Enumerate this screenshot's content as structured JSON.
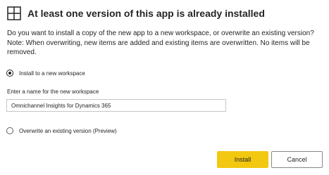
{
  "dialog": {
    "title": "At least one version of this app is already installed",
    "icon": "app-grid-icon",
    "description_line1": "Do you want to install a copy of the new app to a new workspace, or overwrite an existing version?",
    "description_line2": "Note: When overwriting, new items are added and existing items are overwritten. No items will be removed."
  },
  "options": {
    "new_workspace_label": "Install to a new workspace",
    "new_workspace_selected": true,
    "overwrite_label": "Overwrite an existing version (Preview)",
    "overwrite_selected": false
  },
  "workspace_name": {
    "label": "Enter a name for the new workspace",
    "value": "Omnichannel Insights for Dynamics 365"
  },
  "buttons": {
    "install_label": "Install",
    "cancel_label": "Cancel"
  },
  "colors": {
    "primary": "#f2c811",
    "text": "#252423",
    "border": "#c8c6c4"
  }
}
